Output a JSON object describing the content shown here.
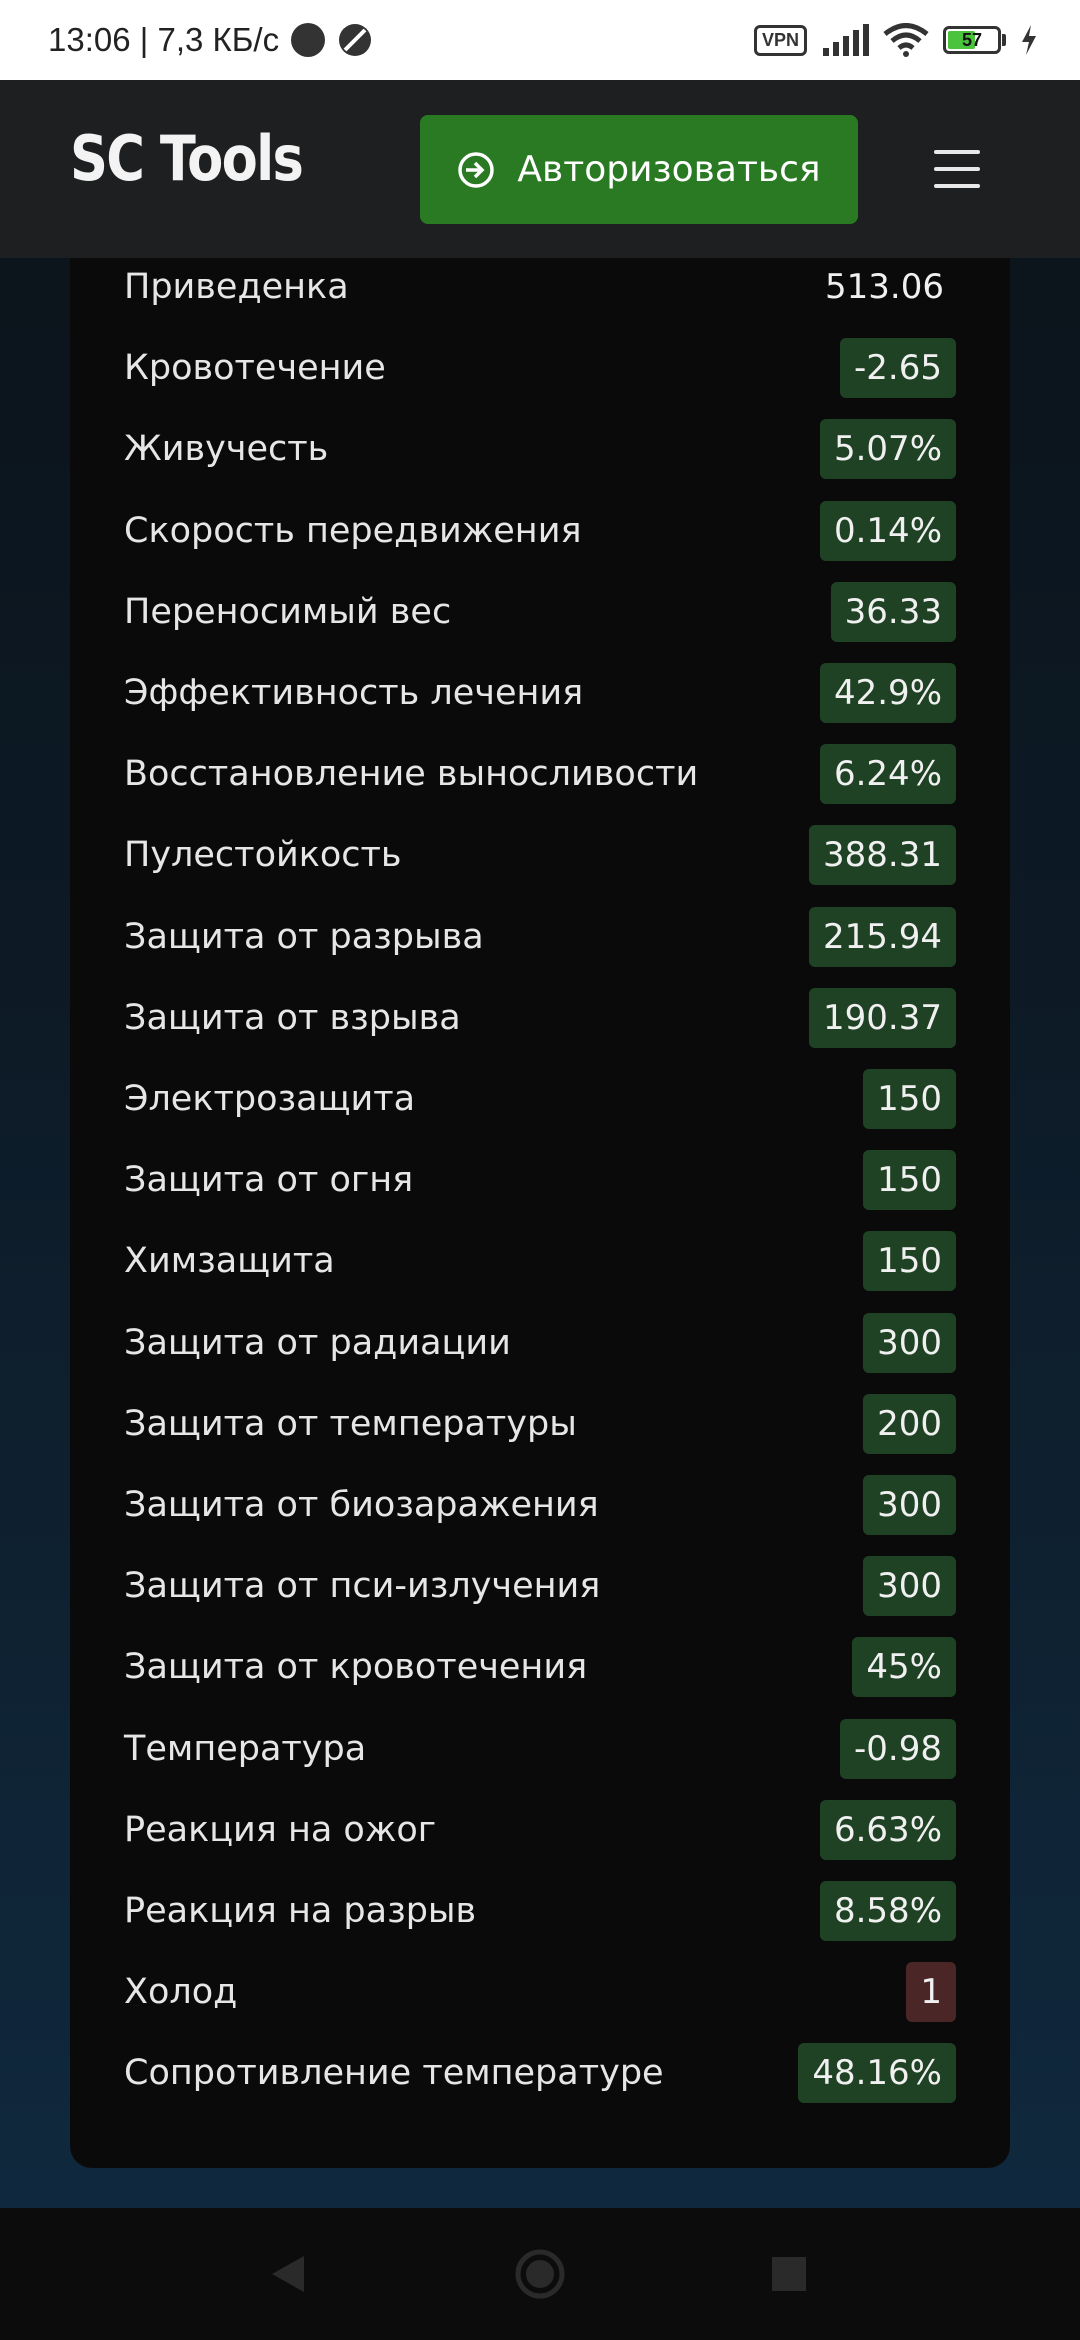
{
  "status_bar": {
    "time_speed": "13:06 | 7,3 КБ/с",
    "vpn_label": "VPN",
    "battery_level": 57,
    "battery_label": "57"
  },
  "header": {
    "brand": "SC Tools",
    "login_label": "Авторизоваться"
  },
  "colors": {
    "good_badge": "#1f4224",
    "bad_badge": "#4a2626",
    "login_button": "#2a7a23"
  },
  "stats": [
    {
      "label": "Приведенка",
      "value": "513.06",
      "state": "plain"
    },
    {
      "label": "Кровотечение",
      "value": "-2.65",
      "state": "good"
    },
    {
      "label": "Живучесть",
      "value": "5.07%",
      "state": "good"
    },
    {
      "label": "Скорость передвижения",
      "value": "0.14%",
      "state": "good"
    },
    {
      "label": "Переносимый вес",
      "value": "36.33",
      "state": "good"
    },
    {
      "label": "Эффективность лечения",
      "value": "42.9%",
      "state": "good"
    },
    {
      "label": "Восстановление выносливости",
      "value": "6.24%",
      "state": "good"
    },
    {
      "label": "Пулестойкость",
      "value": "388.31",
      "state": "good"
    },
    {
      "label": "Защита от разрыва",
      "value": "215.94",
      "state": "good"
    },
    {
      "label": "Защита от взрыва",
      "value": "190.37",
      "state": "good"
    },
    {
      "label": "Электрозащита",
      "value": "150",
      "state": "good"
    },
    {
      "label": "Защита от огня",
      "value": "150",
      "state": "good"
    },
    {
      "label": "Химзащита",
      "value": "150",
      "state": "good"
    },
    {
      "label": "Защита от радиации",
      "value": "300",
      "state": "good"
    },
    {
      "label": "Защита от температуры",
      "value": "200",
      "state": "good"
    },
    {
      "label": "Защита от биозаражения",
      "value": "300",
      "state": "good"
    },
    {
      "label": "Защита от пси-излучения",
      "value": "300",
      "state": "good"
    },
    {
      "label": "Защита от кровотечения",
      "value": "45%",
      "state": "good"
    },
    {
      "label": "Температура",
      "value": "-0.98",
      "state": "good"
    },
    {
      "label": "Реакция на ожог",
      "value": "6.63%",
      "state": "good"
    },
    {
      "label": "Реакция на разрыв",
      "value": "8.58%",
      "state": "good"
    },
    {
      "label": "Холод",
      "value": "1",
      "state": "bad"
    },
    {
      "label": "Сопротивление температуре",
      "value": "48.16%",
      "state": "good"
    }
  ],
  "nav": {
    "back_icon": "back-triangle-icon",
    "home_icon": "home-circle-icon",
    "recents_icon": "recents-square-icon"
  }
}
